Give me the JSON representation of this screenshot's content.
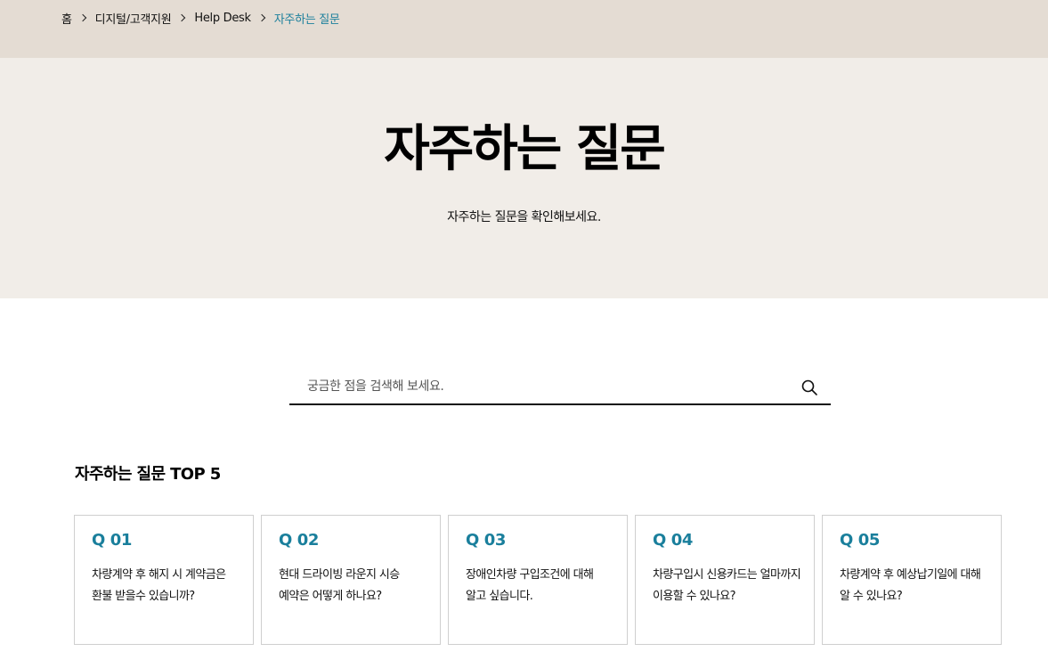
{
  "breadcrumb": {
    "items": [
      "홈",
      "디지털/고객지원",
      "Help Desk",
      "자주하는 질문"
    ]
  },
  "hero": {
    "title": "자주하는 질문",
    "subtitle": "자주하는 질문을 확인해보세요."
  },
  "search": {
    "placeholder": "궁금한 점을 검색해 보세요.",
    "value": "",
    "icon": "search-icon"
  },
  "top5": {
    "title": "자주하는 질문 TOP 5",
    "items": [
      {
        "number": "Q 01",
        "question": "차량계약 후 해지 시 계약금은 환불 받을수 있습니까?"
      },
      {
        "number": "Q 02",
        "question": "현대 드라이빙 라운지 시승 예약은 어떻게 하나요?"
      },
      {
        "number": "Q 03",
        "question": "장애인차량 구입조건에 대해 알고 싶습니다."
      },
      {
        "number": "Q 04",
        "question": "차량구입시 신용카드는 얼마까지 이용할 수 있나요?"
      },
      {
        "number": "Q 05",
        "question": "차량계약 후 예상납기일에 대해 알 수 있나요?"
      }
    ]
  },
  "colors": {
    "breadcrumb_bg": "#e4dcd3",
    "hero_bg": "#f1ede8",
    "accent": "#1a7f9c"
  }
}
